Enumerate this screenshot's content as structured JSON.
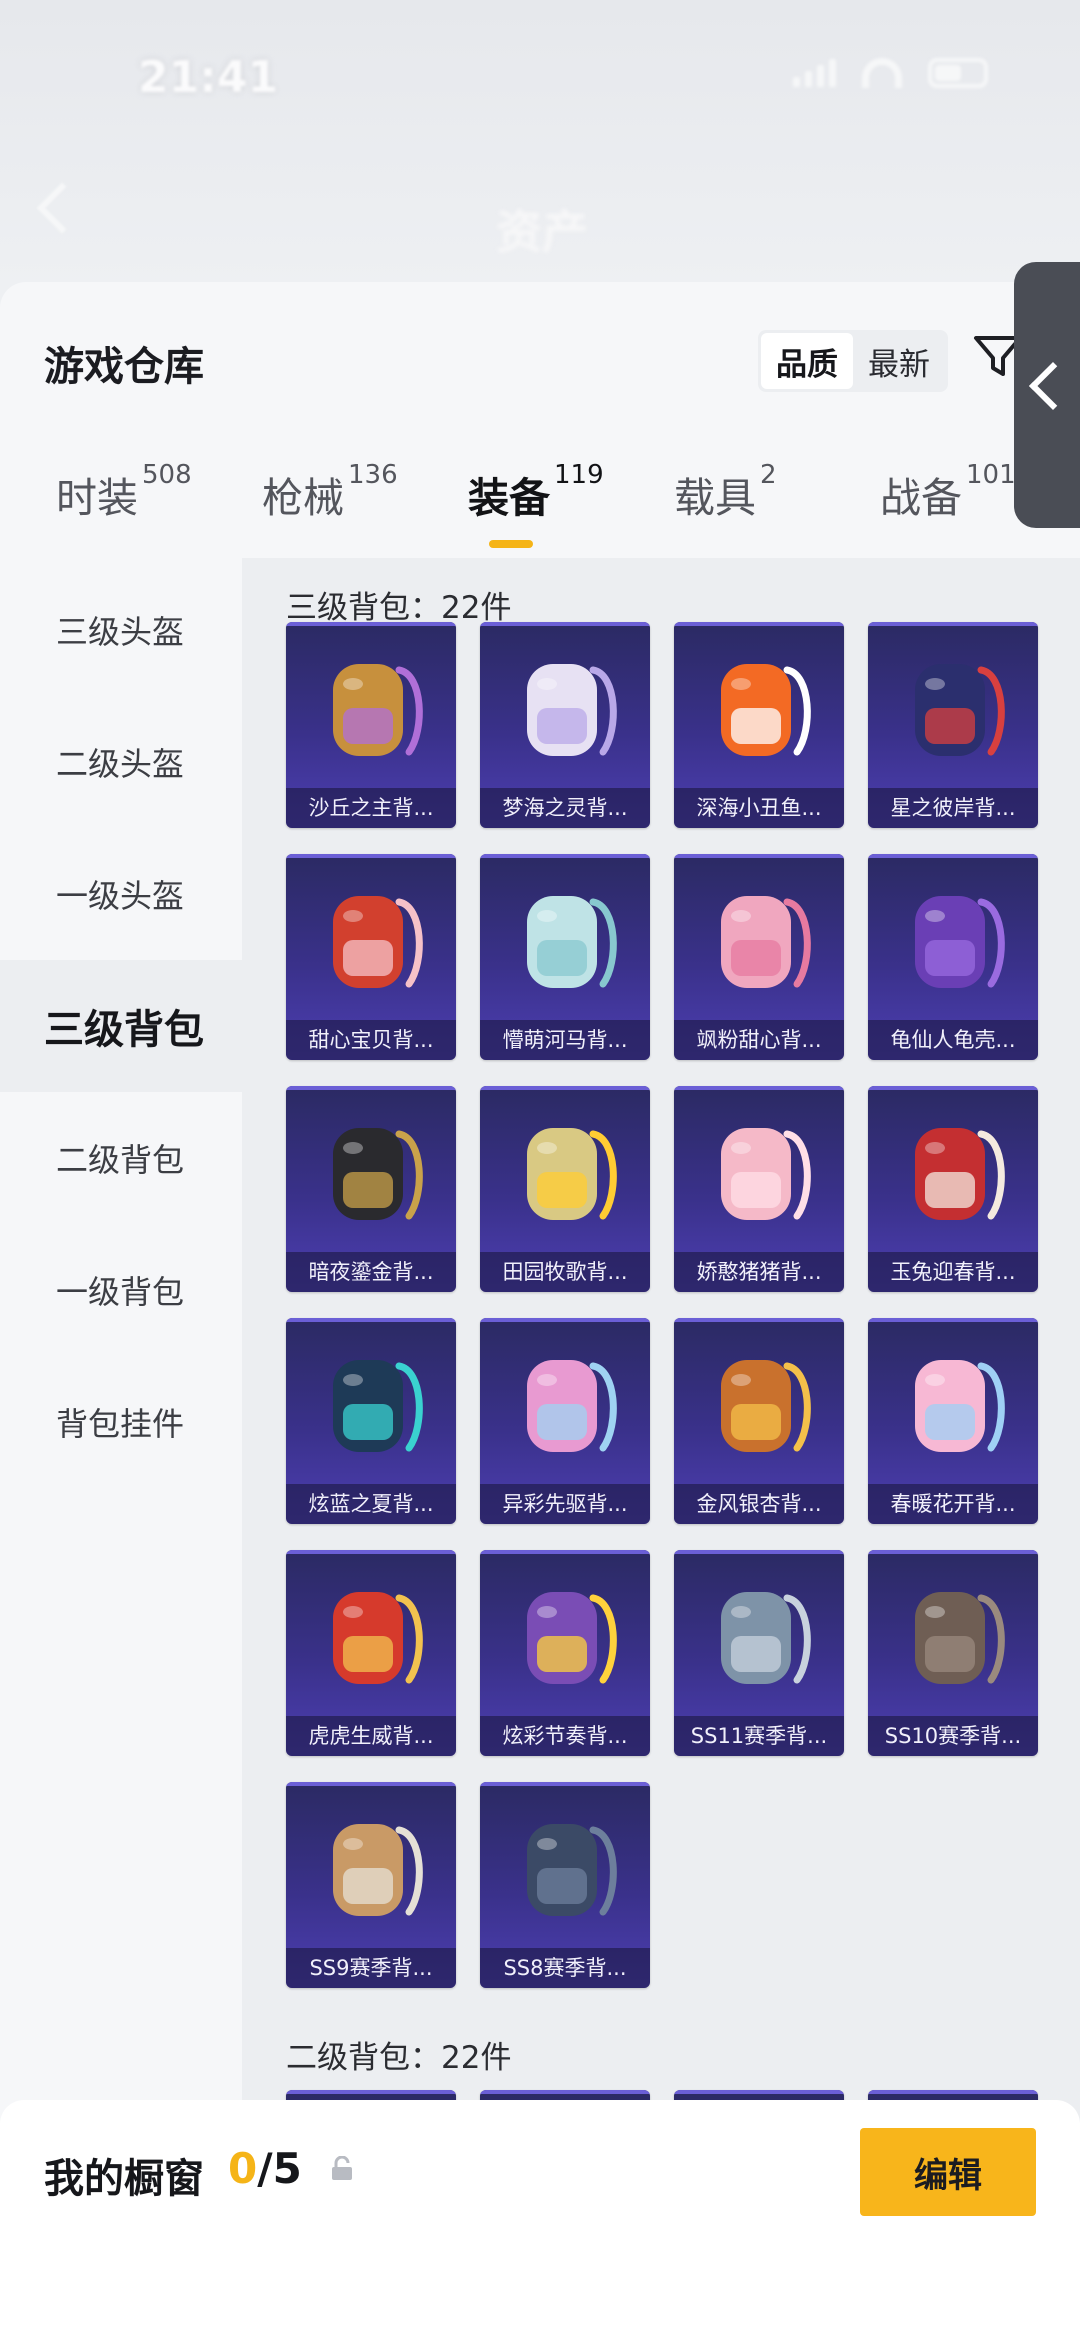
{
  "status": {
    "time": "21:41"
  },
  "nav": {
    "title": "资产"
  },
  "sheet": {
    "title": "游戏仓库"
  },
  "sort": {
    "options": [
      "品质",
      "最新"
    ],
    "active": "品质"
  },
  "tabs": [
    {
      "label": "时装",
      "count": "508"
    },
    {
      "label": "枪械",
      "count": "136"
    },
    {
      "label": "装备",
      "count": "119"
    },
    {
      "label": "载具",
      "count": "2"
    },
    {
      "label": "战备",
      "count": "101"
    }
  ],
  "sidebar": {
    "items": [
      "三级头盔",
      "二级头盔",
      "一级头盔",
      "三级背包",
      "二级背包",
      "一级背包",
      "背包挂件"
    ],
    "active": "三级背包"
  },
  "sections": [
    {
      "title": "三级背包：22件"
    },
    {
      "title": "二级背包：22件"
    }
  ],
  "items": [
    {
      "name": "沙丘之主背...",
      "icon": "scroll-icon",
      "color": "#c7903d",
      "accent": "#b06fd8"
    },
    {
      "name": "梦海之灵背...",
      "icon": "jellyfish-icon",
      "color": "#e7e1f3",
      "accent": "#b9a8e8"
    },
    {
      "name": "深海小丑鱼...",
      "icon": "clownfish-icon",
      "color": "#f36a24",
      "accent": "#ffffff"
    },
    {
      "name": "星之彼岸背...",
      "icon": "astronaut-icon",
      "color": "#2b2f6e",
      "accent": "#d8403f"
    },
    {
      "name": "甜心宝贝背...",
      "icon": "cake-icon",
      "color": "#d2402e",
      "accent": "#f6c1c8"
    },
    {
      "name": "懵萌河马背...",
      "icon": "hippo-icon",
      "color": "#bfe3e6",
      "accent": "#88c8cf"
    },
    {
      "name": "飒粉甜心背...",
      "icon": "pink-pack-icon",
      "color": "#f0a7bf",
      "accent": "#e77aa0"
    },
    {
      "name": "龟仙人龟壳...",
      "icon": "turtle-shell-icon",
      "color": "#6a3fb5",
      "accent": "#9a6be0"
    },
    {
      "name": "暗夜鎏金背...",
      "icon": "dark-gold-icon",
      "color": "#2a2a2e",
      "accent": "#c9a24a"
    },
    {
      "name": "田园牧歌背...",
      "icon": "basket-icon",
      "color": "#d9c983",
      "accent": "#ffcc33"
    },
    {
      "name": "娇憨猪猪背...",
      "icon": "pig-icon",
      "color": "#f5b9c8",
      "accent": "#ffdfe7"
    },
    {
      "name": "玉兔迎春背...",
      "icon": "rabbit-pack-icon",
      "color": "#c42f31",
      "accent": "#f4eadf"
    },
    {
      "name": "炫蓝之夏背...",
      "icon": "blue-pack-icon",
      "color": "#1e3a57",
      "accent": "#3ad2d0"
    },
    {
      "name": "异彩先驱背...",
      "icon": "pastel-pack-icon",
      "color": "#e89ad1",
      "accent": "#9fd3f2"
    },
    {
      "name": "金风银杏背...",
      "icon": "ginkgo-icon",
      "color": "#c9712d",
      "accent": "#f4c04a"
    },
    {
      "name": "春暖花开背...",
      "icon": "flower-pack-icon",
      "color": "#f7b8d4",
      "accent": "#9fd0f5"
    },
    {
      "name": "虎虎生威背...",
      "icon": "tiger-pack-icon",
      "color": "#d63a2c",
      "accent": "#f2c24f"
    },
    {
      "name": "炫彩节奏背...",
      "icon": "graffiti-pack-icon",
      "color": "#7a4db5",
      "accent": "#ffd23c"
    },
    {
      "name": "SS11赛季背...",
      "icon": "camo-pack-icon",
      "color": "#7e93a8",
      "accent": "#c8d2dd"
    },
    {
      "name": "SS10赛季背...",
      "icon": "brown-pack-icon",
      "color": "#6f5e54",
      "accent": "#9a8a7e"
    },
    {
      "name": "SS9赛季背...",
      "icon": "tan-pack-icon",
      "color": "#c99a66",
      "accent": "#e5e0d6"
    },
    {
      "name": "SS8赛季背...",
      "icon": "navy-pack-icon",
      "color": "#3b4a66",
      "accent": "#6d7f9c"
    }
  ],
  "showcase": {
    "label": "我的橱窗",
    "current": "0",
    "total": "/5",
    "edit_label": "编辑"
  }
}
